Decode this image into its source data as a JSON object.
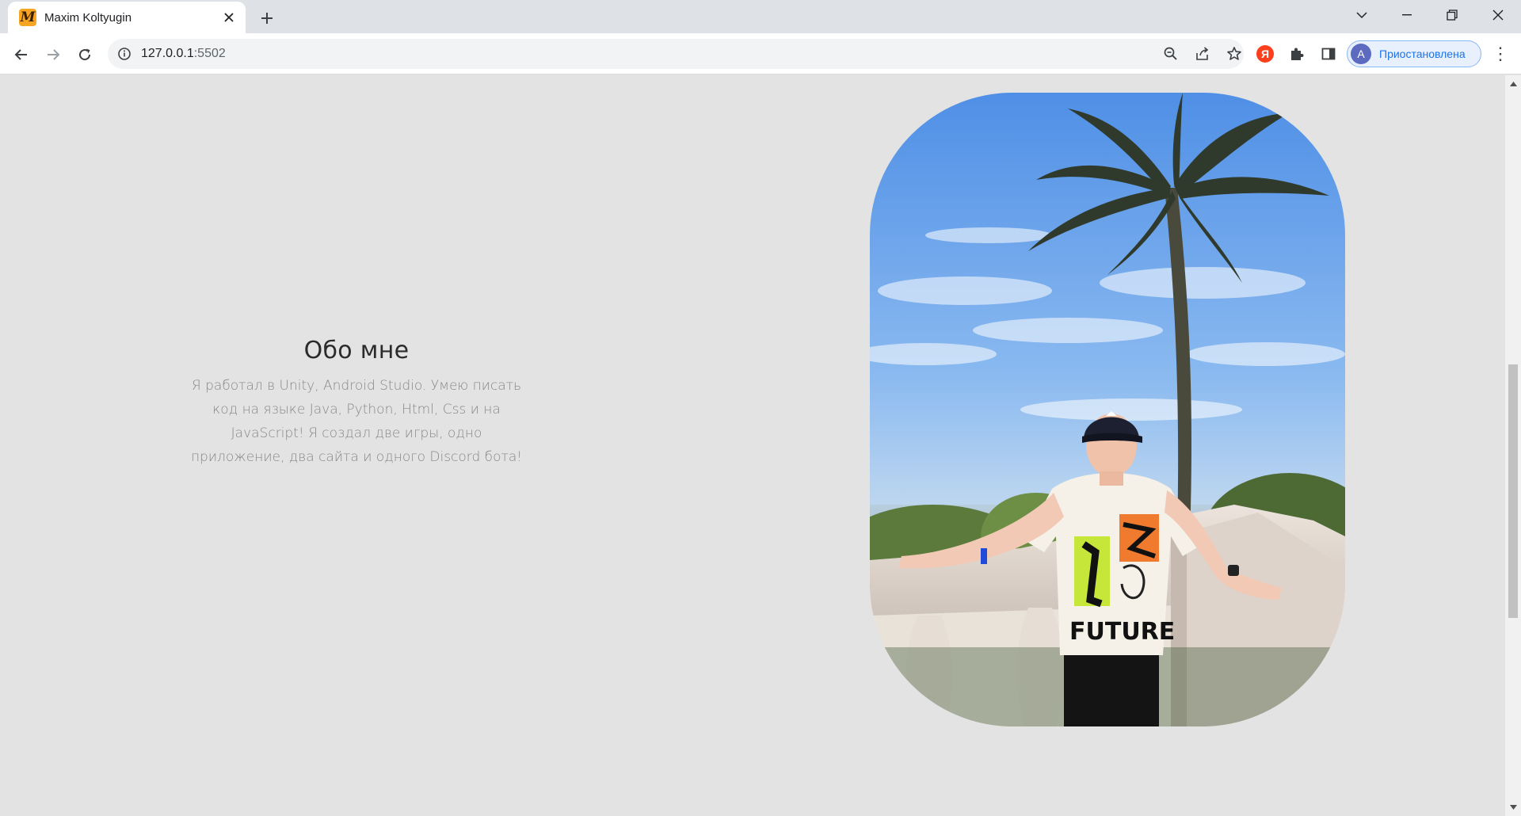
{
  "browser": {
    "tab": {
      "title": "Maxim Koltyugin",
      "favicon_letter": "M",
      "close_glyph": "✕"
    },
    "new_tab_glyph": "+",
    "address": {
      "host": "127.0.0.1",
      "port": ":5502"
    },
    "profile": {
      "avatar_letter": "A",
      "status": "Приостановлена"
    },
    "menu_glyph": "⋮",
    "extensions": {
      "yandex_letter": "Я"
    }
  },
  "page": {
    "about": {
      "title": "Обо мне",
      "text": "Я работал в Unity, Android Studio. Умею писать код на языке Java, Python, Html, Css и на JavaScript! Я создал две игры, одно приложение, два сайта и одного Discord бота!"
    },
    "photo": {
      "shirt_text": "FUTURE"
    }
  },
  "colors": {
    "page_background": "#e3e3e3",
    "title": "#2b2b2b",
    "body_text": "#888888",
    "profile_accent": "#1a73e8"
  }
}
